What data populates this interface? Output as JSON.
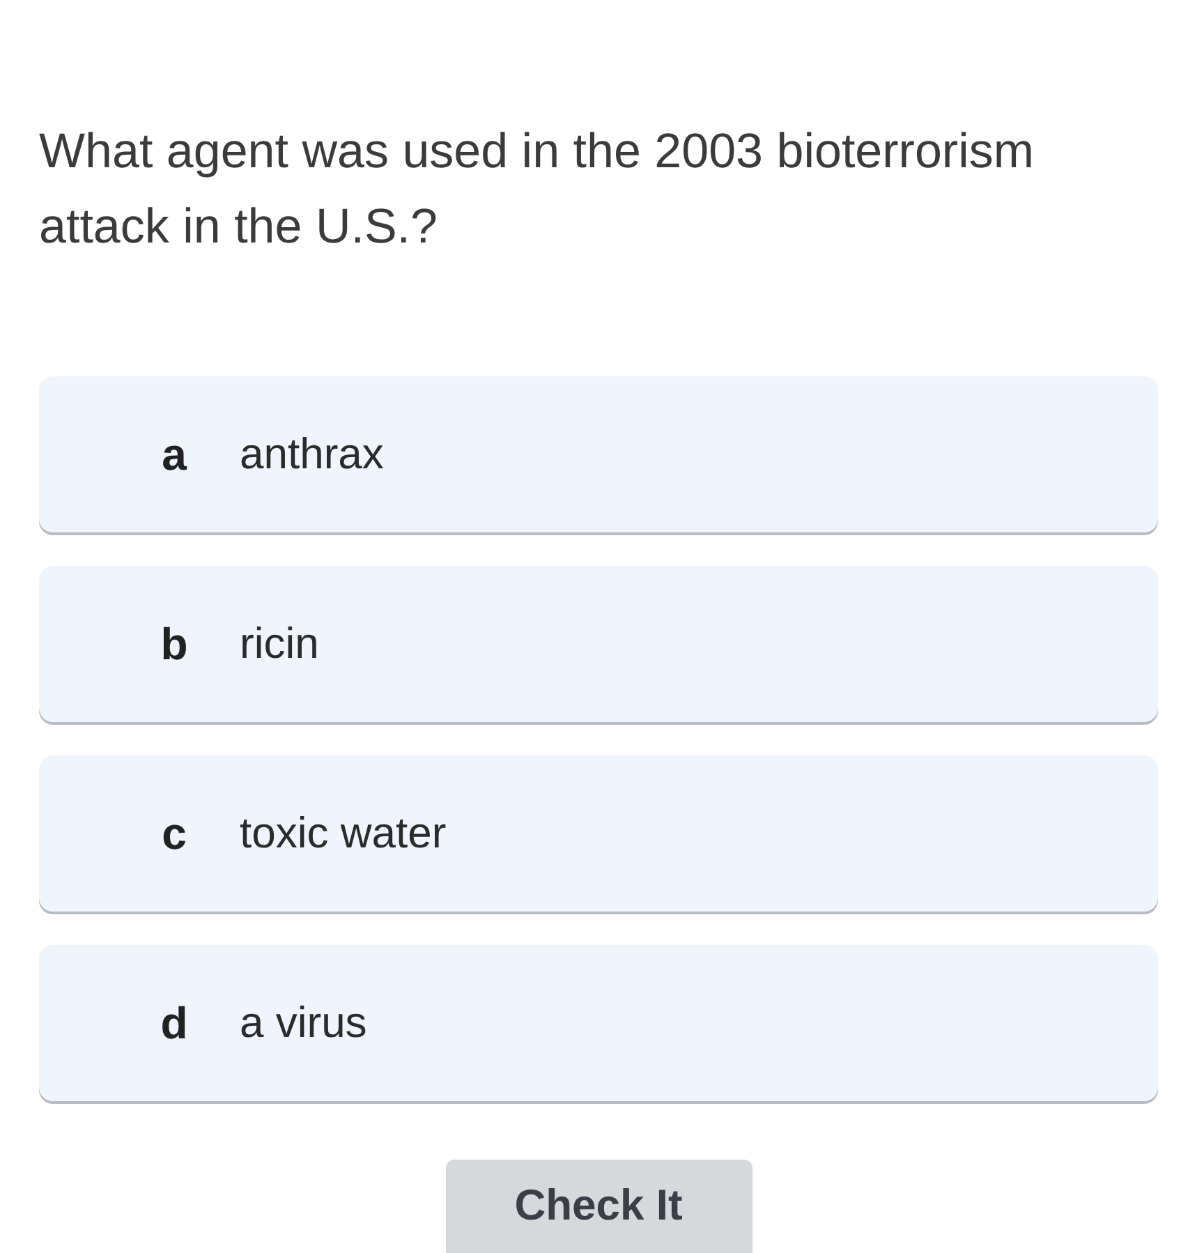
{
  "question": "What agent was used in the 2003 bioterrorism attack in the U.S.?",
  "options": [
    {
      "letter": "a",
      "text": "anthrax",
      "selected": false
    },
    {
      "letter": "b",
      "text": "ricin",
      "selected": false
    },
    {
      "letter": "c",
      "text": "toxic water",
      "selected": false
    },
    {
      "letter": "d",
      "text": "a virus",
      "selected": false
    }
  ],
  "button": "Check It"
}
